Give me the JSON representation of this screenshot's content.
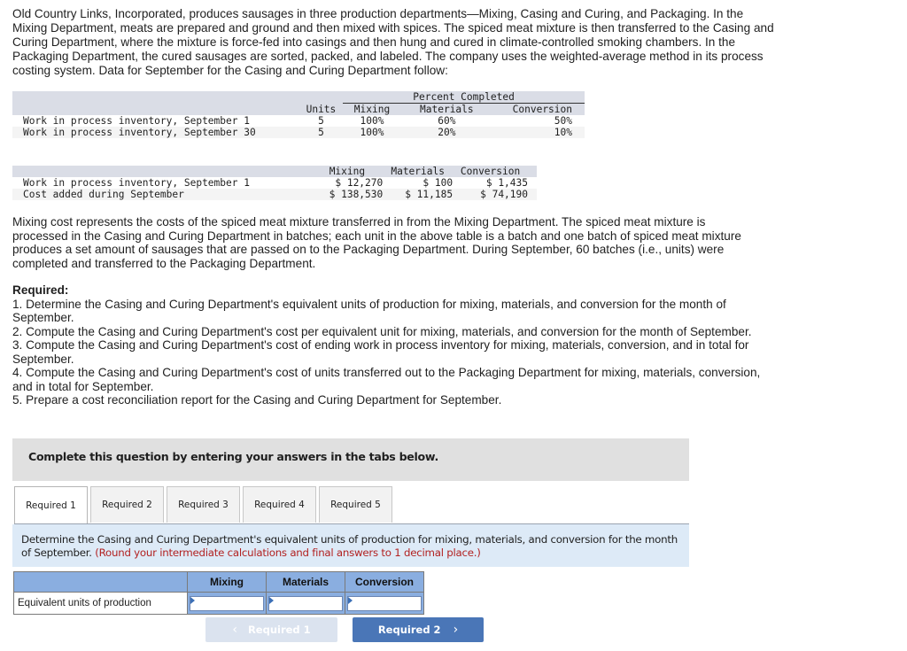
{
  "intro": "Old Country Links, Incorporated, produces sausages in three production departments—Mixing, Casing and Curing, and Packaging. In the Mixing Department, meats are prepared and ground and then mixed with spices. The spiced meat mixture is then transferred to the Casing and Curing Department, where the mixture is force-fed into casings and then hung and cured in climate-controlled smoking chambers. In the Packaging Department, the cured sausages are sorted, packed, and labeled. The company uses the weighted-average method in its process costing system. Data for September for the Casing and Curing Department follow:",
  "units_table": {
    "group_header": "Percent Completed",
    "headers": {
      "units": "Units",
      "mixing": "Mixing",
      "materials": "Materials",
      "conversion": "Conversion"
    },
    "rows": [
      {
        "label": "Work in process inventory, September 1",
        "units": "5",
        "mixing": "100%",
        "materials": "60%",
        "conversion": "50%"
      },
      {
        "label": "Work in process inventory, September 30",
        "units": "5",
        "mixing": "100%",
        "materials": "20%",
        "conversion": "10%"
      }
    ]
  },
  "cost_table": {
    "headers": {
      "mixing": "Mixing",
      "materials": "Materials",
      "conversion": "Conversion"
    },
    "rows": [
      {
        "label": "Work in process inventory, September 1",
        "mixing": "$ 12,270",
        "materials": "$ 100",
        "conversion": "$ 1,435"
      },
      {
        "label": "Cost added during September",
        "mixing": "$ 138,530",
        "materials": "$ 11,185",
        "conversion": "$ 74,190"
      }
    ]
  },
  "para2": "Mixing cost represents the costs of the spiced meat mixture transferred in from the Mixing Department. The spiced meat mixture is processed in the Casing and Curing Department in batches; each unit in the above table is a batch and one batch of spiced meat mixture produces a set amount of sausages that are passed on to the Packaging Department. During September, 60 batches (i.e., units) were completed and transferred to the Packaging Department.",
  "required": {
    "title": "Required:",
    "items": [
      "1. Determine the Casing and Curing Department's equivalent units of production for mixing, materials, and conversion for the month of September.",
      "2. Compute the Casing and Curing Department's cost per equivalent unit for mixing, materials, and conversion for the month of September.",
      "3. Compute the Casing and Curing Department's cost of ending work in process inventory for mixing, materials, conversion, and in total for September.",
      "4. Compute the Casing and Curing Department's cost of units transferred out to the Packaging Department for mixing, materials, conversion, and in total for September.",
      "5. Prepare a cost reconciliation report for the Casing and Curing Department for September."
    ]
  },
  "banner": "Complete this question by entering your answers in the tabs below.",
  "tabs": [
    {
      "label": "Required 1",
      "active": true
    },
    {
      "label": "Required 2",
      "active": false
    },
    {
      "label": "Required 3",
      "active": false
    },
    {
      "label": "Required 4",
      "active": false
    },
    {
      "label": "Required 5",
      "active": false
    }
  ],
  "instruction": {
    "text": "Determine the Casing and Curing Department's equivalent units of production for mixing, materials, and conversion for the month of September.",
    "note": "(Round your intermediate calculations and final answers to 1 decimal place.)"
  },
  "answer_table": {
    "headers": {
      "mixing": "Mixing",
      "materials": "Materials",
      "conversion": "Conversion"
    },
    "row_label": "Equivalent units of production",
    "values": {
      "mixing": "",
      "materials": "",
      "conversion": ""
    }
  },
  "nav": {
    "prev_label": "Required 1",
    "next_label": "Required 2",
    "prev_icon": "chevron-left-icon",
    "next_icon": "chevron-right-icon"
  },
  "colors": {
    "header_gray": "#dadde6",
    "banner_gray": "#e0e0e0",
    "instruction_blue": "#ddeaf7",
    "table_header_blue": "#8aaee0",
    "next_button": "#4a76b7",
    "prev_button_disabled": "#dbe3ef",
    "note_red": "#b22222"
  }
}
